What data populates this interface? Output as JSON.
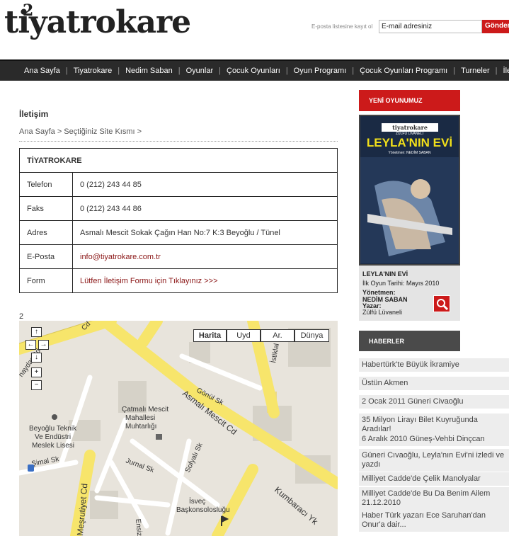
{
  "header": {
    "logo_text": "tiyatrokare",
    "logo_superscript": "2",
    "subscribe_label": "E-posta listesine kayıt ol",
    "email_value": "E-mail adresiniz",
    "send_label": "Gönder"
  },
  "nav": {
    "items": [
      "Ana Sayfa",
      "Tiyatrokare",
      "Nedim Saban",
      "Oyunlar",
      "Çocuk Oyunları",
      "Oyun Programı",
      "Çocuk Oyunları Programı",
      "Turneler",
      "İletişim"
    ],
    "separator": "|"
  },
  "main": {
    "title": "İletişim",
    "breadcrumb": "Ana Sayfa > Seçtiğiniz Site Kısmı >",
    "contact": {
      "heading": "TİYATROKARE",
      "rows": [
        {
          "label": "Telefon",
          "value": "0 (212) 243 44 85"
        },
        {
          "label": "Faks",
          "value": "0 (212) 243 44 86"
        },
        {
          "label": "Adres",
          "value": "Asmalı Mescit Sokak Çağın Han No:7 K:3 Beyoğlu / Tünel"
        },
        {
          "label": "E-Posta",
          "value": "info@tiyatrokare.com.tr"
        },
        {
          "label": "Form",
          "value": "Lütfen İletişim Formu için Tıklayınız >>>"
        }
      ]
    },
    "map_label": "2",
    "map": {
      "types": [
        "Harita",
        "Uyd",
        "Ar.",
        "Dünya"
      ],
      "selected_type": "Harita",
      "controls": {
        "up": "↑",
        "left": "←",
        "right": "→",
        "down": "↓",
        "zoom_in": "+",
        "zoom_out": "−"
      },
      "streets": {
        "asmali": "Asmalı Mescit Cd",
        "istiklal": "İstiklal Cd",
        "gonul": "Gönül Sk",
        "jurnal": "Jurnal Sk",
        "sofyali": "Sofyalı Sk",
        "meşrutiyet": "Meşrutiyet Cd",
        "simal": "Şimal Sk",
        "kumbaraci": "Kumbaracı Yk",
        "ensiz": "Ensiz",
        "cd_top": "Cd",
        "hay": "haydar Cd"
      },
      "places": {
        "muhtarlik1": "Çatmalı Mescit",
        "muhtarlik2": "Mahallesi",
        "muhtarlik3": "Muhtarlığı",
        "lise1": "Beyoğlu Teknik",
        "lise2": "Ve Endüstri",
        "lise3": "Meslek Lisesi",
        "isvec1": "İsveç",
        "isvec2": "Başkonsolosluğu"
      }
    }
  },
  "sidebar": {
    "yeni_header": "YENİ OYUNUMUZ",
    "poster": {
      "brand": "tiyatrokare",
      "author_line": "ZÜLFÜ LİVANELİ",
      "title": "LEYLA'NIN EVİ",
      "director_line": "Yönetmen: NEDİM SABAN"
    },
    "play": {
      "name": "LEYLA'NIN EVİ",
      "date": "İlk Oyun Tarihi: Mayıs 2010",
      "director_label": "Yönetmen:",
      "director": "NEDİM SABAN",
      "writer_label": "Yazar:",
      "writer": "Zülfü Lüvaneli"
    },
    "haber_header": "HABERLER",
    "news": [
      "Habertürk'te Büyük İkramiye",
      "Üstün Akmen",
      "2 Ocak 2011 Güneri Civaoğlu",
      "35 Milyon Lirayı Bilet Kuyruğunda Aradılar!",
      "6 Aralık 2010 Güneş-Vehbi Dinçcan",
      "Güneri Cıvaoğlu, Leyla'nın Evi'ni izledi ve yazdı",
      "Milliyet Cadde'de Çelik Manolyalar",
      "Milliyet Cadde'de Bu Da Benim Ailem 21.12.2010",
      "Haber Türk yazarı Ece Saruhan'dan Onur'a dair..."
    ]
  },
  "colors": {
    "accent": "#cc1a1a",
    "nav_bg": "#2a2a2a",
    "road": "#f7e56b",
    "map_bg": "#e8e4dc"
  }
}
